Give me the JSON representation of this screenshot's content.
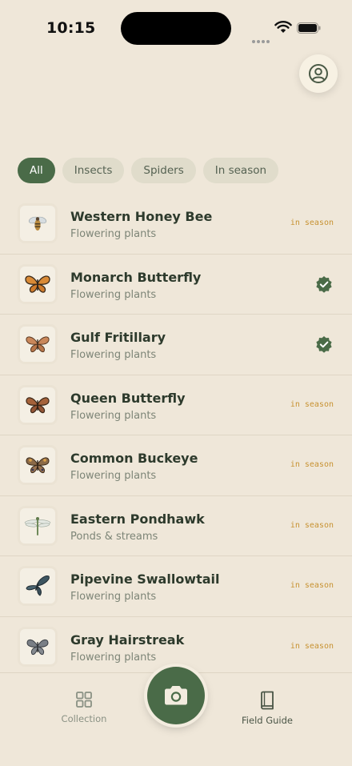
{
  "status_bar": {
    "time": "10:15"
  },
  "filters": [
    {
      "label": "All",
      "active": true
    },
    {
      "label": "Insects",
      "active": false
    },
    {
      "label": "Spiders",
      "active": false
    },
    {
      "label": "In season",
      "active": false
    }
  ],
  "species": [
    {
      "name": "Western Honey Bee",
      "habitat": "Flowering plants",
      "status": "in season",
      "icon": "bee-icon"
    },
    {
      "name": "Monarch Butterfly",
      "habitat": "Flowering plants",
      "status": "verified",
      "icon": "butterfly-icon"
    },
    {
      "name": "Gulf Fritillary",
      "habitat": "Flowering plants",
      "status": "verified",
      "icon": "butterfly-icon"
    },
    {
      "name": "Queen Butterfly",
      "habitat": "Flowering plants",
      "status": "in season",
      "icon": "butterfly-icon"
    },
    {
      "name": "Common Buckeye",
      "habitat": "Flowering plants",
      "status": "in season",
      "icon": "butterfly-icon"
    },
    {
      "name": "Eastern Pondhawk",
      "habitat": "Ponds & streams",
      "status": "in season",
      "icon": "dragonfly-icon"
    },
    {
      "name": "Pipevine Swallowtail",
      "habitat": "Flowering plants",
      "status": "in season",
      "icon": "butterfly-icon"
    },
    {
      "name": "Gray Hairstreak",
      "habitat": "Flowering plants",
      "status": "in season",
      "icon": "butterfly-icon"
    }
  ],
  "tabbar": {
    "collection_label": "Collection",
    "field_guide_label": "Field Guide"
  },
  "colors": {
    "accent": "#4a6b48",
    "background": "#efe7d9",
    "season": "#c79232"
  }
}
